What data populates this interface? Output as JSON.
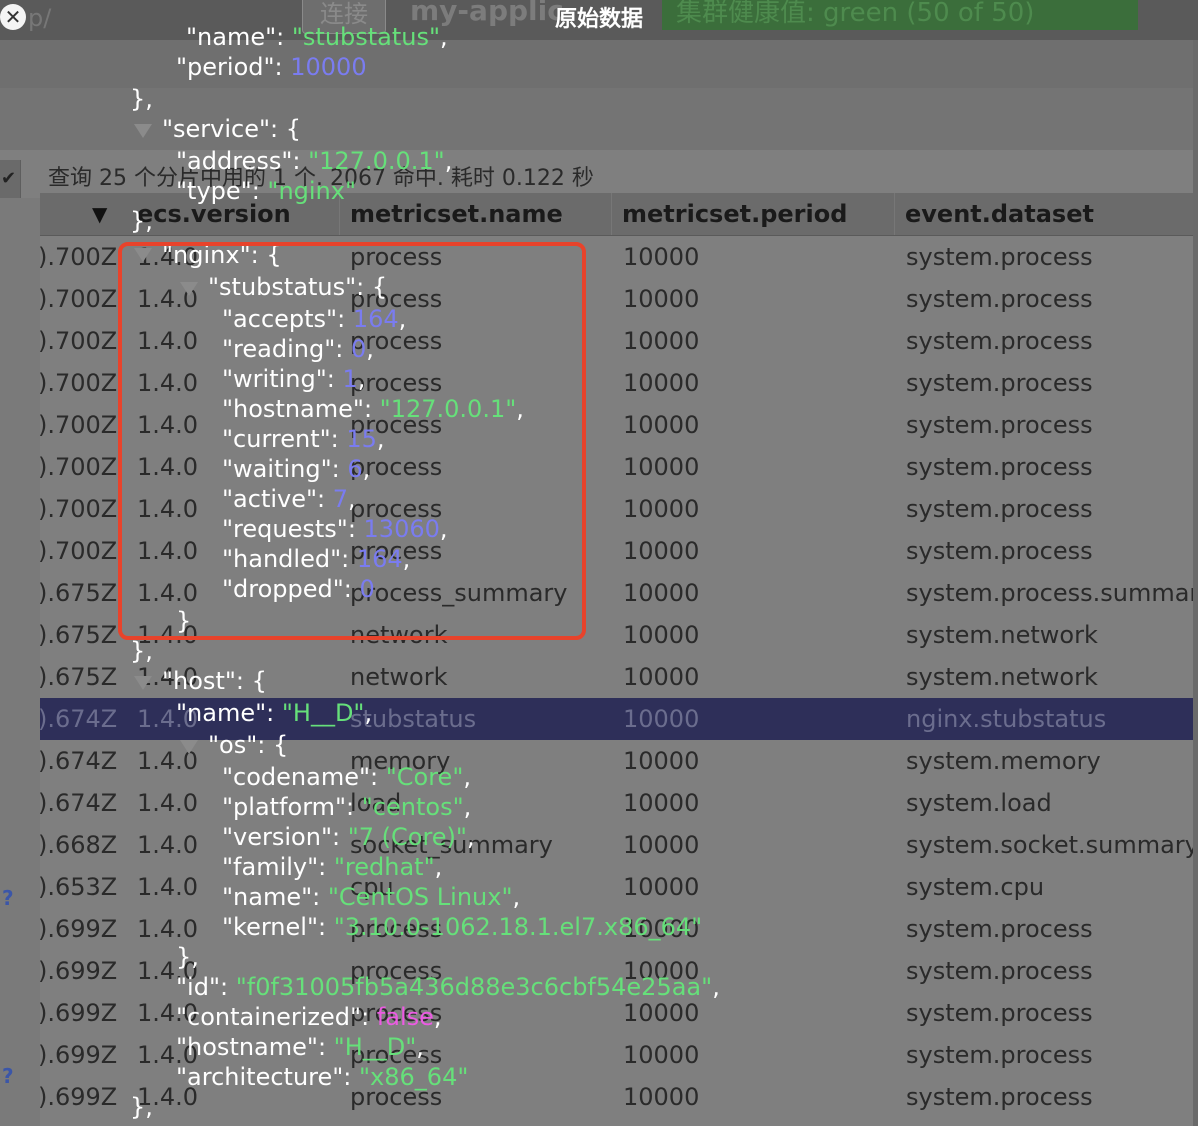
{
  "topbar": {
    "path": "p/",
    "connect_label": "连接",
    "app_name": "my-applic",
    "health": "集群健康值: green (50 of 50)"
  },
  "modal": {
    "title": "原始数据",
    "close_icon": "close-icon"
  },
  "query_summary": "查询 25 个分片中用的 1 个. 2067 命中. 耗时 0.122 秒",
  "table": {
    "sort_indicator": "▼",
    "columns": [
      "ecs.version",
      "metricset.name",
      "metricset.period",
      "event.dataset"
    ],
    "rows": [
      {
        "time": ").700Z",
        "ver": "1.4.0",
        "ms": "process",
        "per": "10000",
        "ds": "system.process"
      },
      {
        "time": ").700Z",
        "ver": "1.4.0",
        "ms": "process",
        "per": "10000",
        "ds": "system.process"
      },
      {
        "time": ").700Z",
        "ver": "1.4.0",
        "ms": "process",
        "per": "10000",
        "ds": "system.process"
      },
      {
        "time": ").700Z",
        "ver": "1.4.0",
        "ms": "process",
        "per": "10000",
        "ds": "system.process"
      },
      {
        "time": ").700Z",
        "ver": "1.4.0",
        "ms": "process",
        "per": "10000",
        "ds": "system.process"
      },
      {
        "time": ").700Z",
        "ver": "1.4.0",
        "ms": "process",
        "per": "10000",
        "ds": "system.process"
      },
      {
        "time": ").700Z",
        "ver": "1.4.0",
        "ms": "process",
        "per": "10000",
        "ds": "system.process"
      },
      {
        "time": ").700Z",
        "ver": "1.4.0",
        "ms": "process",
        "per": "10000",
        "ds": "system.process"
      },
      {
        "time": ").675Z",
        "ver": "1.4.0",
        "ms": "process_summary",
        "per": "10000",
        "ds": "system.process.summar"
      },
      {
        "time": ").675Z",
        "ver": "1.4.0",
        "ms": "network",
        "per": "10000",
        "ds": "system.network"
      },
      {
        "time": ").675Z",
        "ver": "1.4.0",
        "ms": "network",
        "per": "10000",
        "ds": "system.network"
      },
      {
        "time": ").674Z",
        "ver": "1.4.0",
        "ms": "stubstatus",
        "per": "10000",
        "ds": "nginx.stubstatus"
      },
      {
        "time": ").674Z",
        "ver": "1.4.0",
        "ms": "memory",
        "per": "10000",
        "ds": "system.memory"
      },
      {
        "time": ").674Z",
        "ver": "1.4.0",
        "ms": "load",
        "per": "10000",
        "ds": "system.load"
      },
      {
        "time": ").668Z",
        "ver": "1.4.0",
        "ms": "socket_summary",
        "per": "10000",
        "ds": "system.socket.summary"
      },
      {
        "time": ").653Z",
        "ver": "1.4.0",
        "ms": "cpu",
        "per": "10000",
        "ds": "system.cpu"
      },
      {
        "time": ").699Z",
        "ver": "1.4.0",
        "ms": "process",
        "per": "10000",
        "ds": "system.process"
      },
      {
        "time": ").699Z",
        "ver": "1.4.0",
        "ms": "process",
        "per": "10000",
        "ds": "system.process"
      },
      {
        "time": ").699Z",
        "ver": "1.4.0",
        "ms": "process",
        "per": "10000",
        "ds": "system.process"
      },
      {
        "time": ").699Z",
        "ver": "1.4.0",
        "ms": "process",
        "per": "10000",
        "ds": "system.process"
      },
      {
        "time": ").699Z",
        "ver": "1.4.0",
        "ms": "process",
        "per": "10000",
        "ds": "system.process"
      }
    ],
    "selected_row": 11
  },
  "json_lines": [
    {
      "k": "\"name\": ",
      "v": "\"stubstatus\"",
      "t": "s",
      "after": ","
    },
    {
      "k": "\"period\": ",
      "v": "10000",
      "t": "n",
      "after": ""
    },
    {
      "k": "},",
      "v": "",
      "t": "",
      "after": ""
    },
    {
      "k": "\"service\": {",
      "v": "",
      "t": "",
      "after": ""
    },
    {
      "k": "\"address\": ",
      "v": "\"127.0.0.1\"",
      "t": "s",
      "after": ","
    },
    {
      "k": "\"type\": ",
      "v": "\"nginx\"",
      "t": "s",
      "after": ""
    },
    {
      "k": "},",
      "v": "",
      "t": "",
      "after": ""
    },
    {
      "k": "\"nginx\": {",
      "v": "",
      "t": "",
      "after": ""
    },
    {
      "k": "\"stubstatus\": {",
      "v": "",
      "t": "",
      "after": ""
    },
    {
      "k": "\"accepts\": ",
      "v": "164",
      "t": "n",
      "after": ","
    },
    {
      "k": "\"reading\": ",
      "v": "0",
      "t": "n",
      "after": ","
    },
    {
      "k": "\"writing\": ",
      "v": "1",
      "t": "n",
      "after": ","
    },
    {
      "k": "\"hostname\": ",
      "v": "\"127.0.0.1\"",
      "t": "s",
      "after": ","
    },
    {
      "k": "\"current\": ",
      "v": "15",
      "t": "n",
      "after": ","
    },
    {
      "k": "\"waiting\": ",
      "v": "6",
      "t": "n",
      "after": ","
    },
    {
      "k": "\"active\": ",
      "v": "7",
      "t": "n",
      "after": ","
    },
    {
      "k": "\"requests\": ",
      "v": "13060",
      "t": "n",
      "after": ","
    },
    {
      "k": "\"handled\": ",
      "v": "164",
      "t": "n",
      "after": ","
    },
    {
      "k": "\"dropped\": ",
      "v": "0",
      "t": "n",
      "after": ""
    },
    {
      "k": "}",
      "v": "",
      "t": "",
      "after": ""
    },
    {
      "k": "},",
      "v": "",
      "t": "",
      "after": ""
    },
    {
      "k": "\"host\": {",
      "v": "",
      "t": "",
      "after": ""
    },
    {
      "k": "\"name\": ",
      "v": "\"H__D\"",
      "t": "s",
      "after": ","
    },
    {
      "k": "\"os\": {",
      "v": "",
      "t": "",
      "after": ""
    },
    {
      "k": "\"codename\": ",
      "v": "\"Core\"",
      "t": "s",
      "after": ","
    },
    {
      "k": "\"platform\": ",
      "v": "\"centos\"",
      "t": "s",
      "after": ","
    },
    {
      "k": "\"version\": ",
      "v": "\"7 (Core)\"",
      "t": "s",
      "after": ","
    },
    {
      "k": "\"family\": ",
      "v": "\"redhat\"",
      "t": "s",
      "after": ","
    },
    {
      "k": "\"name\": ",
      "v": "\"CentOS Linux\"",
      "t": "s",
      "after": ","
    },
    {
      "k": "\"kernel\": ",
      "v": "\"3.10.0-1062.18.1.el7.x86_64\"",
      "t": "s",
      "after": ""
    },
    {
      "k": "},",
      "v": "",
      "t": "",
      "after": ""
    },
    {
      "k": "\"id\": ",
      "v": "\"f0f31005fb5a436d88e3c6cbf54e25aa\"",
      "t": "s",
      "after": ","
    },
    {
      "k": "\"containerized\": ",
      "v": "false",
      "t": "b",
      "after": ","
    },
    {
      "k": "\"hostname\": ",
      "v": "\"H__D\"",
      "t": "s",
      "after": ","
    },
    {
      "k": "\"architecture\": ",
      "v": "\"x86_64\"",
      "t": "s",
      "after": ""
    },
    {
      "k": "},",
      "v": "",
      "t": "",
      "after": ""
    }
  ],
  "colors": {
    "string": "#66e07a",
    "number": "#7a7cf0",
    "boolean": "#ec5be3",
    "highlight_box": "#e8432b",
    "selected_row": "#2e2f59"
  }
}
